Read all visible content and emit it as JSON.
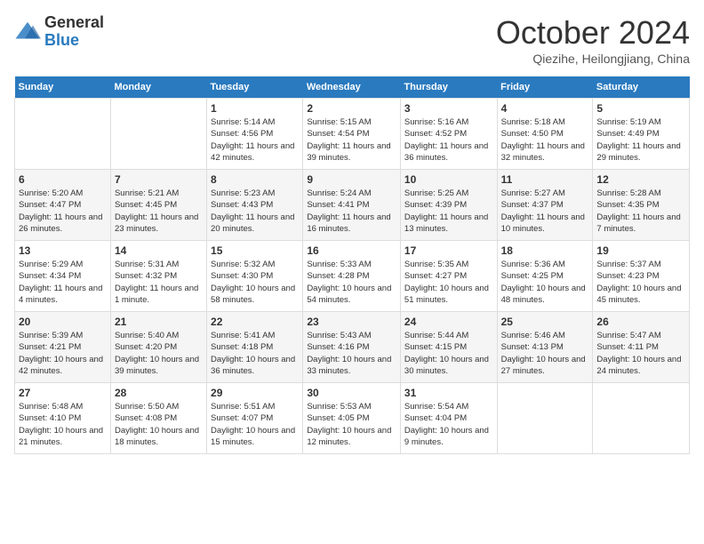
{
  "logo": {
    "general": "General",
    "blue": "Blue"
  },
  "title": "October 2024",
  "location": "Qiezihe, Heilongjiang, China",
  "days_of_week": [
    "Sunday",
    "Monday",
    "Tuesday",
    "Wednesday",
    "Thursday",
    "Friday",
    "Saturday"
  ],
  "weeks": [
    [
      {
        "num": "",
        "sunrise": "",
        "sunset": "",
        "daylight": ""
      },
      {
        "num": "",
        "sunrise": "",
        "sunset": "",
        "daylight": ""
      },
      {
        "num": "1",
        "sunrise": "Sunrise: 5:14 AM",
        "sunset": "Sunset: 4:56 PM",
        "daylight": "Daylight: 11 hours and 42 minutes."
      },
      {
        "num": "2",
        "sunrise": "Sunrise: 5:15 AM",
        "sunset": "Sunset: 4:54 PM",
        "daylight": "Daylight: 11 hours and 39 minutes."
      },
      {
        "num": "3",
        "sunrise": "Sunrise: 5:16 AM",
        "sunset": "Sunset: 4:52 PM",
        "daylight": "Daylight: 11 hours and 36 minutes."
      },
      {
        "num": "4",
        "sunrise": "Sunrise: 5:18 AM",
        "sunset": "Sunset: 4:50 PM",
        "daylight": "Daylight: 11 hours and 32 minutes."
      },
      {
        "num": "5",
        "sunrise": "Sunrise: 5:19 AM",
        "sunset": "Sunset: 4:49 PM",
        "daylight": "Daylight: 11 hours and 29 minutes."
      }
    ],
    [
      {
        "num": "6",
        "sunrise": "Sunrise: 5:20 AM",
        "sunset": "Sunset: 4:47 PM",
        "daylight": "Daylight: 11 hours and 26 minutes."
      },
      {
        "num": "7",
        "sunrise": "Sunrise: 5:21 AM",
        "sunset": "Sunset: 4:45 PM",
        "daylight": "Daylight: 11 hours and 23 minutes."
      },
      {
        "num": "8",
        "sunrise": "Sunrise: 5:23 AM",
        "sunset": "Sunset: 4:43 PM",
        "daylight": "Daylight: 11 hours and 20 minutes."
      },
      {
        "num": "9",
        "sunrise": "Sunrise: 5:24 AM",
        "sunset": "Sunset: 4:41 PM",
        "daylight": "Daylight: 11 hours and 16 minutes."
      },
      {
        "num": "10",
        "sunrise": "Sunrise: 5:25 AM",
        "sunset": "Sunset: 4:39 PM",
        "daylight": "Daylight: 11 hours and 13 minutes."
      },
      {
        "num": "11",
        "sunrise": "Sunrise: 5:27 AM",
        "sunset": "Sunset: 4:37 PM",
        "daylight": "Daylight: 11 hours and 10 minutes."
      },
      {
        "num": "12",
        "sunrise": "Sunrise: 5:28 AM",
        "sunset": "Sunset: 4:35 PM",
        "daylight": "Daylight: 11 hours and 7 minutes."
      }
    ],
    [
      {
        "num": "13",
        "sunrise": "Sunrise: 5:29 AM",
        "sunset": "Sunset: 4:34 PM",
        "daylight": "Daylight: 11 hours and 4 minutes."
      },
      {
        "num": "14",
        "sunrise": "Sunrise: 5:31 AM",
        "sunset": "Sunset: 4:32 PM",
        "daylight": "Daylight: 11 hours and 1 minute."
      },
      {
        "num": "15",
        "sunrise": "Sunrise: 5:32 AM",
        "sunset": "Sunset: 4:30 PM",
        "daylight": "Daylight: 10 hours and 58 minutes."
      },
      {
        "num": "16",
        "sunrise": "Sunrise: 5:33 AM",
        "sunset": "Sunset: 4:28 PM",
        "daylight": "Daylight: 10 hours and 54 minutes."
      },
      {
        "num": "17",
        "sunrise": "Sunrise: 5:35 AM",
        "sunset": "Sunset: 4:27 PM",
        "daylight": "Daylight: 10 hours and 51 minutes."
      },
      {
        "num": "18",
        "sunrise": "Sunrise: 5:36 AM",
        "sunset": "Sunset: 4:25 PM",
        "daylight": "Daylight: 10 hours and 48 minutes."
      },
      {
        "num": "19",
        "sunrise": "Sunrise: 5:37 AM",
        "sunset": "Sunset: 4:23 PM",
        "daylight": "Daylight: 10 hours and 45 minutes."
      }
    ],
    [
      {
        "num": "20",
        "sunrise": "Sunrise: 5:39 AM",
        "sunset": "Sunset: 4:21 PM",
        "daylight": "Daylight: 10 hours and 42 minutes."
      },
      {
        "num": "21",
        "sunrise": "Sunrise: 5:40 AM",
        "sunset": "Sunset: 4:20 PM",
        "daylight": "Daylight: 10 hours and 39 minutes."
      },
      {
        "num": "22",
        "sunrise": "Sunrise: 5:41 AM",
        "sunset": "Sunset: 4:18 PM",
        "daylight": "Daylight: 10 hours and 36 minutes."
      },
      {
        "num": "23",
        "sunrise": "Sunrise: 5:43 AM",
        "sunset": "Sunset: 4:16 PM",
        "daylight": "Daylight: 10 hours and 33 minutes."
      },
      {
        "num": "24",
        "sunrise": "Sunrise: 5:44 AM",
        "sunset": "Sunset: 4:15 PM",
        "daylight": "Daylight: 10 hours and 30 minutes."
      },
      {
        "num": "25",
        "sunrise": "Sunrise: 5:46 AM",
        "sunset": "Sunset: 4:13 PM",
        "daylight": "Daylight: 10 hours and 27 minutes."
      },
      {
        "num": "26",
        "sunrise": "Sunrise: 5:47 AM",
        "sunset": "Sunset: 4:11 PM",
        "daylight": "Daylight: 10 hours and 24 minutes."
      }
    ],
    [
      {
        "num": "27",
        "sunrise": "Sunrise: 5:48 AM",
        "sunset": "Sunset: 4:10 PM",
        "daylight": "Daylight: 10 hours and 21 minutes."
      },
      {
        "num": "28",
        "sunrise": "Sunrise: 5:50 AM",
        "sunset": "Sunset: 4:08 PM",
        "daylight": "Daylight: 10 hours and 18 minutes."
      },
      {
        "num": "29",
        "sunrise": "Sunrise: 5:51 AM",
        "sunset": "Sunset: 4:07 PM",
        "daylight": "Daylight: 10 hours and 15 minutes."
      },
      {
        "num": "30",
        "sunrise": "Sunrise: 5:53 AM",
        "sunset": "Sunset: 4:05 PM",
        "daylight": "Daylight: 10 hours and 12 minutes."
      },
      {
        "num": "31",
        "sunrise": "Sunrise: 5:54 AM",
        "sunset": "Sunset: 4:04 PM",
        "daylight": "Daylight: 10 hours and 9 minutes."
      },
      {
        "num": "",
        "sunrise": "",
        "sunset": "",
        "daylight": ""
      },
      {
        "num": "",
        "sunrise": "",
        "sunset": "",
        "daylight": ""
      }
    ]
  ]
}
